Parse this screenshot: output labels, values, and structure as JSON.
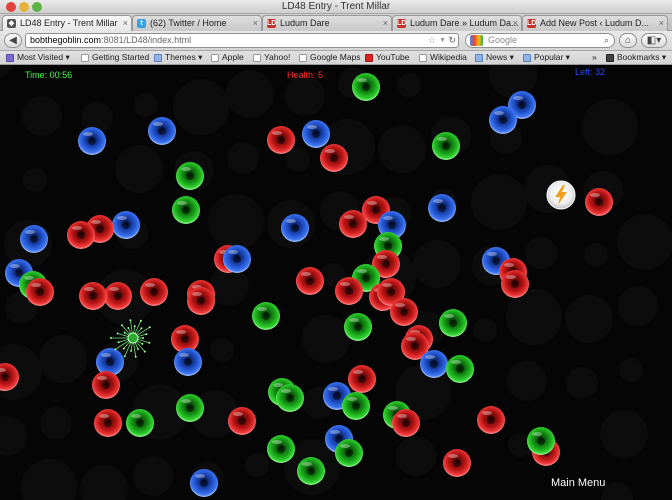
{
  "window": {
    "title": "LD48 Entry - Trent Millar"
  },
  "tabs": [
    {
      "label": "LD48 Entry - Trent Millar",
      "favicon": "game-favicon",
      "active": true
    },
    {
      "label": "(62) Twitter / Home",
      "favicon": "twitter-favicon",
      "active": false
    },
    {
      "label": "Ludum Dare",
      "favicon": "ld-favicon",
      "active": false
    },
    {
      "label": "Ludum Dare » Ludum Da...",
      "favicon": "ld-favicon",
      "active": false
    },
    {
      "label": "Add New Post ‹ Ludum D...",
      "favicon": "ld-favicon",
      "active": false
    }
  ],
  "navbar": {
    "url_host": "bobthegoblin.com",
    "url_rest": ":8081/LD48/index.html",
    "search_placeholder": "Google"
  },
  "bookmarks": [
    {
      "label": "Most Visited ▾",
      "icon": "most-visited-icon"
    },
    {
      "label": "Getting Started",
      "icon": "page-icon"
    },
    {
      "label": "Themes ▾",
      "icon": "folder-icon"
    },
    {
      "label": "Apple",
      "icon": "page-icon"
    },
    {
      "label": "Yahoo!",
      "icon": "page-icon"
    },
    {
      "label": "Google Maps",
      "icon": "page-icon"
    },
    {
      "label": "YouTube",
      "icon": "youtube-icon"
    },
    {
      "label": "Wikipedia",
      "icon": "page-icon"
    },
    {
      "label": "News ▾",
      "icon": "folder-icon"
    },
    {
      "label": "Popular ▾",
      "icon": "folder-icon"
    },
    {
      "label": "Bookmarks ▾",
      "icon": "bookmarks-icon"
    }
  ],
  "game": {
    "time_text": "Time: 00:56",
    "health_text": "Health: 5",
    "left_text": "Left: 32",
    "main_menu_label": "Main Menu",
    "colors": {
      "red": "#e8242a",
      "green": "#22c022",
      "blue": "#2a5fe0",
      "power": "#f0a020"
    }
  }
}
